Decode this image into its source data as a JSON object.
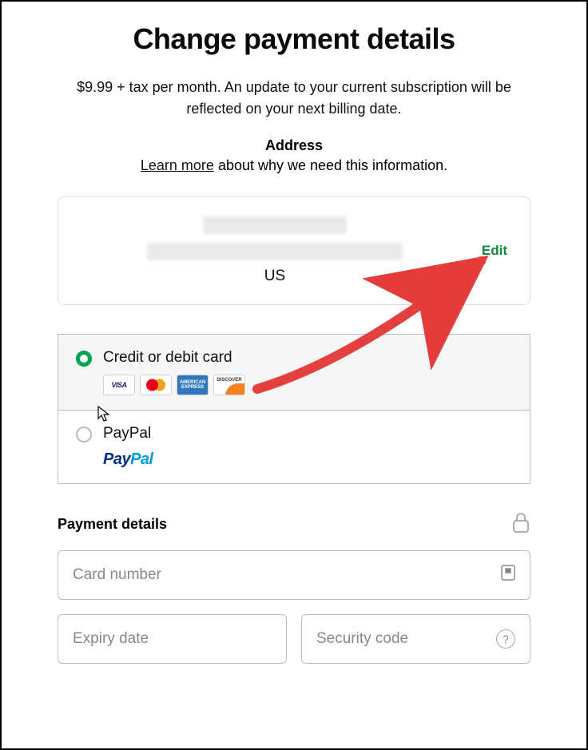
{
  "title": "Change payment details",
  "subtext": "$9.99 + tax per month. An update to your current subscription will be reflected on your next billing date.",
  "address": {
    "heading": "Address",
    "learn_link": "Learn more",
    "learn_rest": " about why we need this information.",
    "country": "US",
    "edit_label": "Edit"
  },
  "methods": {
    "card_label": "Credit or debit card",
    "paypal_label": "PayPal"
  },
  "payment": {
    "section_label": "Payment details",
    "card_number_placeholder": "Card number",
    "expiry_placeholder": "Expiry date",
    "security_placeholder": "Security code"
  }
}
